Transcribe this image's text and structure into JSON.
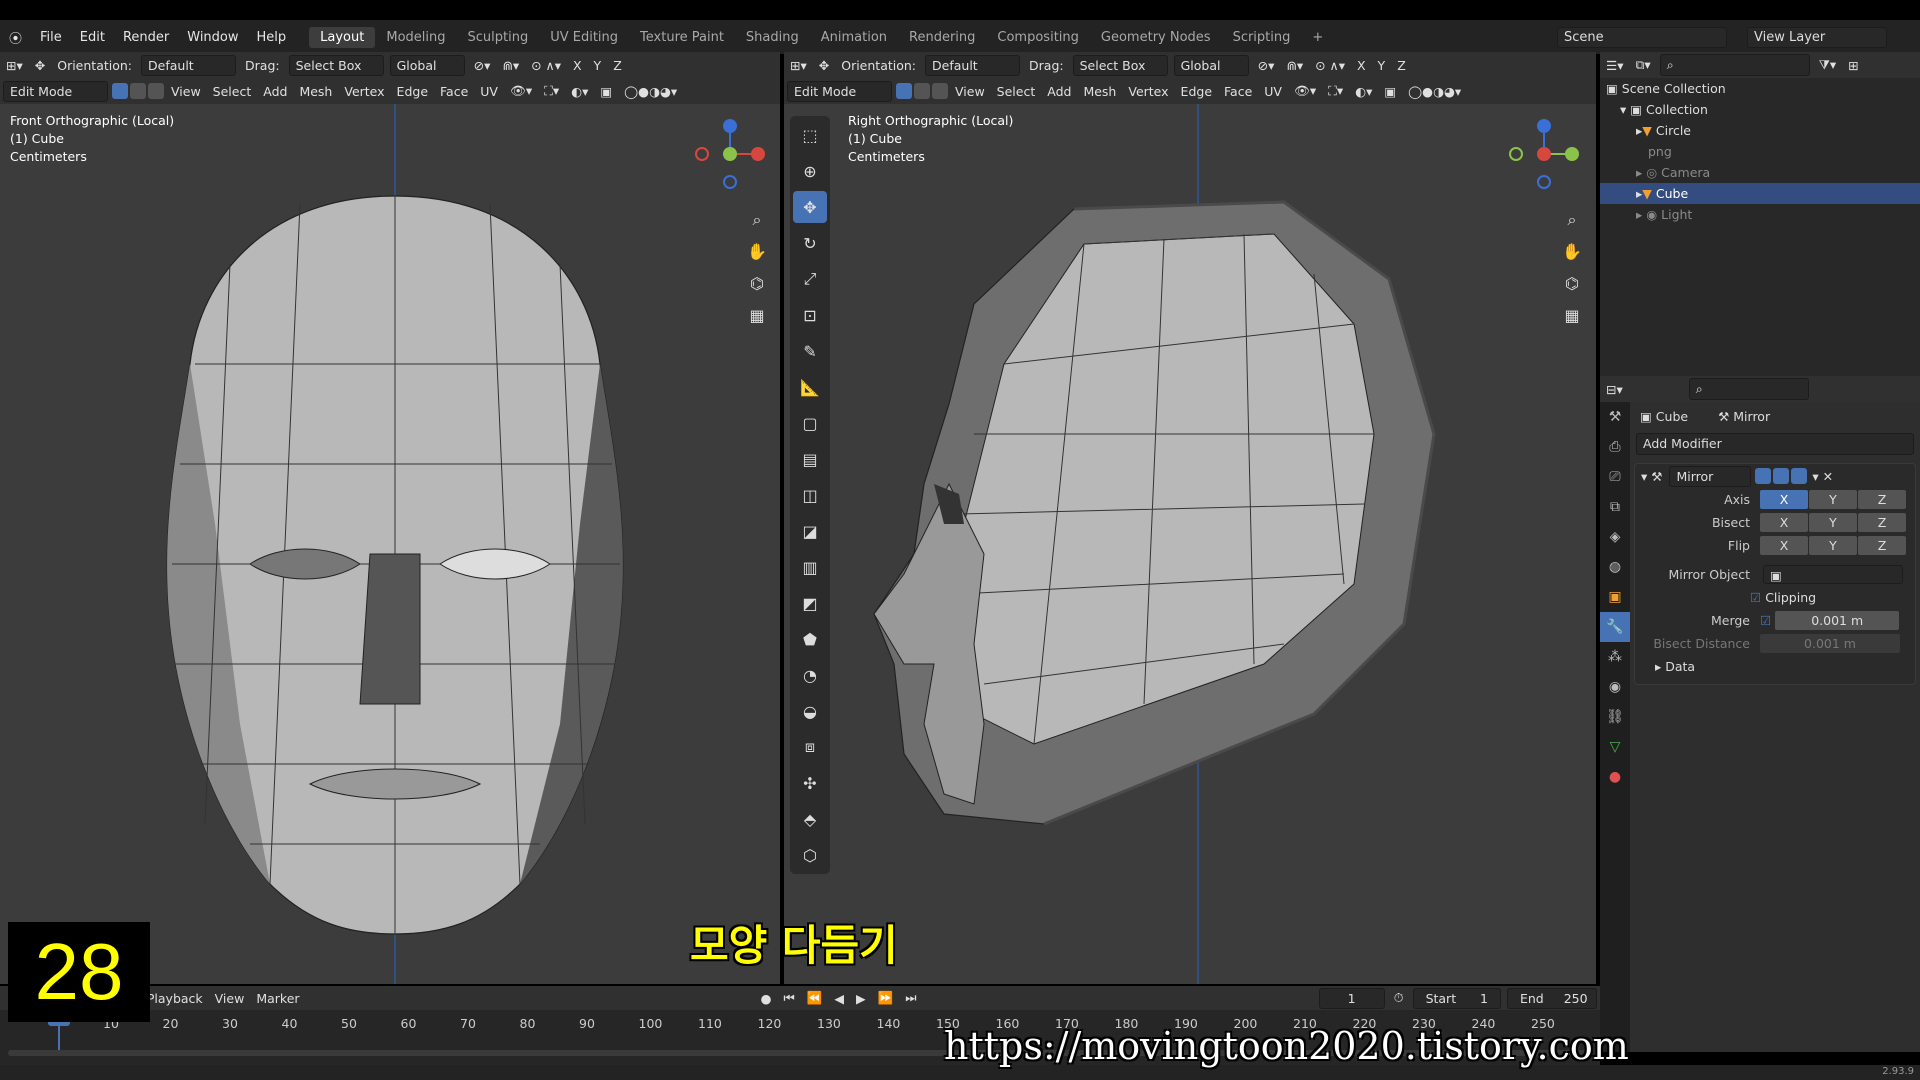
{
  "menu": {
    "items": [
      "File",
      "Edit",
      "Render",
      "Window",
      "Help"
    ]
  },
  "workspaces": [
    "Layout",
    "Modeling",
    "Sculpting",
    "UV Editing",
    "Texture Paint",
    "Shading",
    "Animation",
    "Rendering",
    "Compositing",
    "Geometry Nodes",
    "Scripting"
  ],
  "active_workspace": "Layout",
  "scene": {
    "label": "Scene",
    "view_layer": "View Layer"
  },
  "header": {
    "orientation_label": "Orientation:",
    "orientation_value": "Default",
    "drag_label": "Drag:",
    "drag_value": "Select Box",
    "transform_space": "Global",
    "axes": [
      "X",
      "Y",
      "Z"
    ]
  },
  "header2": {
    "mode": "Edit Mode",
    "menus": [
      "View",
      "Select",
      "Add",
      "Mesh",
      "Vertex",
      "Edge",
      "Face",
      "UV"
    ]
  },
  "left_view": {
    "title": "Front Orthographic (Local)",
    "object": "(1) Cube",
    "units": "Centimeters"
  },
  "right_view": {
    "title": "Right Orthographic (Local)",
    "object": "(1) Cube",
    "units": "Centimeters"
  },
  "outliner": {
    "items": [
      {
        "label": "Scene Collection",
        "type": "scene"
      },
      {
        "label": "Collection",
        "type": "collection"
      },
      {
        "label": "Circle",
        "type": "object"
      },
      {
        "label": "png",
        "type": "image"
      },
      {
        "label": "Camera",
        "type": "camera"
      },
      {
        "label": "Cube",
        "type": "mesh"
      },
      {
        "label": "Light",
        "type": "light"
      }
    ]
  },
  "properties": {
    "object": "Cube",
    "modifier_tab": "Mirror",
    "add_modifier": "Add Modifier",
    "modifier_name": "Mirror",
    "axis_label": "Axis",
    "bisect_label": "Bisect",
    "flip_label": "Flip",
    "xyz": [
      "X",
      "Y",
      "Z"
    ],
    "mirror_object_label": "Mirror Object",
    "clipping_label": "Clipping",
    "merge_label": "Merge",
    "merge_value": "0.001 m",
    "bisect_distance_label": "Bisect Distance",
    "bisect_distance_value": "0.001 m",
    "data_label": "Data"
  },
  "timeline": {
    "menus": [
      "Playback",
      "View",
      "Marker"
    ],
    "current_frame": "1",
    "start_label": "Start",
    "start": "1",
    "end_label": "End",
    "end": "250",
    "ticks": [
      "10",
      "20",
      "30",
      "40",
      "50",
      "60",
      "70",
      "80",
      "90",
      "100",
      "110",
      "120",
      "130",
      "140",
      "150",
      "160",
      "170",
      "180",
      "190",
      "200",
      "210",
      "220",
      "230",
      "240",
      "250"
    ]
  },
  "overlay": {
    "episode_number": "28",
    "subtitle": "모양 다듬기",
    "watermark": "https://movingtoon2020.tistory.com"
  },
  "version": "2.93.9",
  "colors": {
    "accent": "#4772b3",
    "selected_row": "#334d80",
    "viewport_bg": "#3c3c3c",
    "mesh": "#b4b4b4",
    "episode_fg": "#ffff00"
  }
}
